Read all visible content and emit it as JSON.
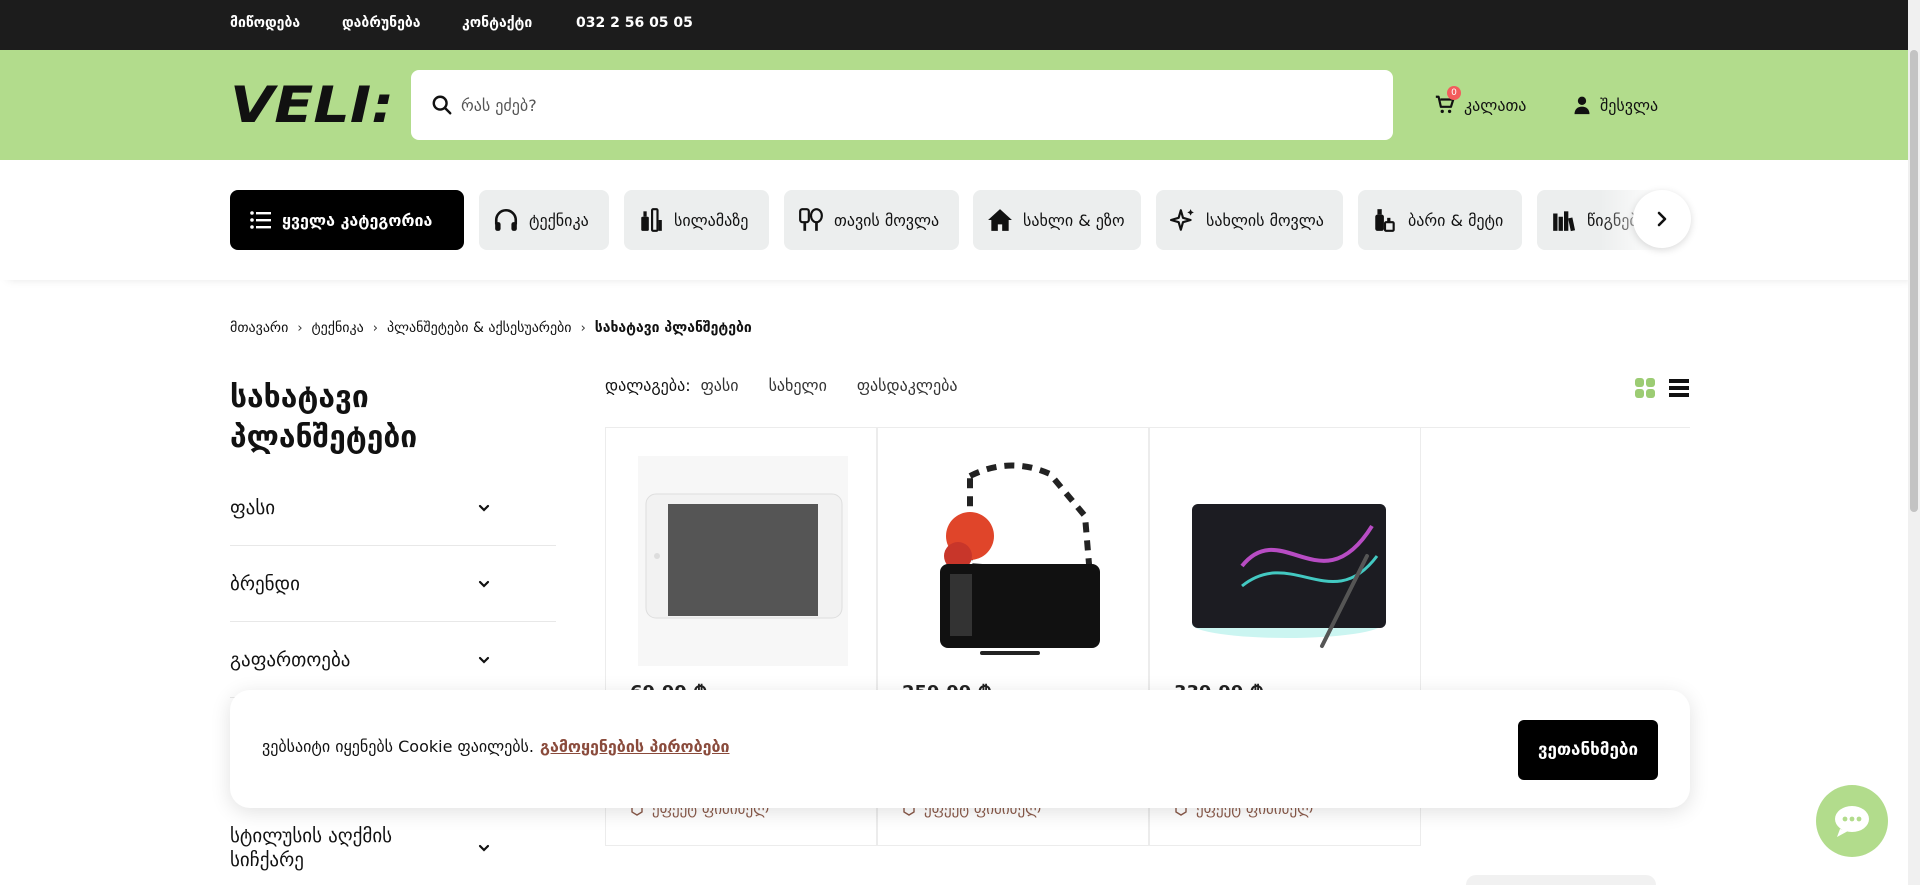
{
  "topbar": {
    "links": [
      {
        "label": "მიწოდება",
        "name": "topbar-link-delivery"
      },
      {
        "label": "დაბრუნება",
        "name": "topbar-link-returns"
      },
      {
        "label": "კონტაქტი",
        "name": "topbar-link-contact"
      },
      {
        "label": "032 2 56 05 05",
        "name": "topbar-phone"
      }
    ]
  },
  "header": {
    "logo_text": "VELI:",
    "search_placeholder": "რას ეძებ?",
    "cart_label": "კალათა",
    "cart_count": "0",
    "login_label": "შესვლა",
    "brand_color": "#b2dc8c"
  },
  "categories": [
    {
      "label": "ყველა კატეგორია",
      "icon": "list-icon"
    },
    {
      "label": "ტექნიკა",
      "icon": "headphones-icon"
    },
    {
      "label": "სილამაზე",
      "icon": "cosmetics-icon"
    },
    {
      "label": "თავის მოვლა",
      "icon": "mirror-icon"
    },
    {
      "label": "სახლი & ეზო",
      "icon": "house-icon"
    },
    {
      "label": "სახლის მოვლა",
      "icon": "sparkle-icon"
    },
    {
      "label": "ბარი & მეტი",
      "icon": "bottles-icon"
    },
    {
      "label": "წიგნები",
      "icon": "books-icon"
    }
  ],
  "breadcrumb": [
    "მთავარი",
    "ტექნიკა",
    "პლანშეტები & აქსესუარები",
    "სახატავი პლანშეტები"
  ],
  "page_title": "სახატავი პლანშეტები",
  "filters": [
    "ფასი",
    "ბრენდი",
    "გაფართოება",
    "სტილუსის აღქმის სიჩქარე"
  ],
  "sort": {
    "label": "დალაგება:",
    "options": [
      "ფასი",
      "სახელი",
      "ფასდაკლება"
    ]
  },
  "products": [
    {
      "price": "69.99 ₾",
      "compare": "ეფექტ ფიმიძელ"
    },
    {
      "price": "259.99 ₾",
      "compare": "ეფექტ ფიმიძელ"
    },
    {
      "price": "339.99 ₾",
      "compare": "ეფექტ ფიმიძელ"
    }
  ],
  "cookie": {
    "text": "ვებსაიტი იყენებს Cookie ფაილებს.",
    "link": "გამოყენების პირობები",
    "button": "ვეთანხმები"
  }
}
